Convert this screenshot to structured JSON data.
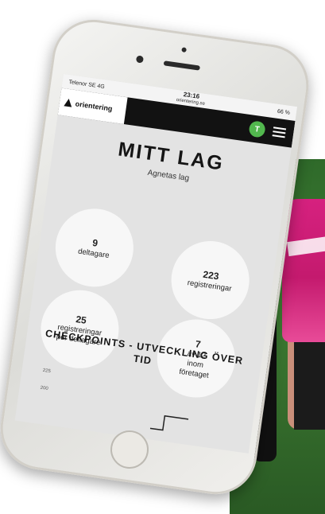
{
  "status_bar": {
    "carrier": "Telenor SE  4G",
    "time": "23:16",
    "url": "orientering.se",
    "battery": "66 %"
  },
  "header": {
    "logo_text": "orientering",
    "avatar_initial": "T",
    "colors": {
      "bar": "#121212",
      "avatar": "#52b84e"
    }
  },
  "page": {
    "title": "MITT LAG",
    "team_name": "Agnetas lag"
  },
  "stats": [
    {
      "number": "9",
      "lines": [
        "deltagare"
      ]
    },
    {
      "number": "223",
      "lines": [
        "registreringar"
      ]
    },
    {
      "number": "25",
      "lines": [
        "registreringar",
        "per deltagare"
      ]
    },
    {
      "number": "7",
      "lines": [
        "av 12",
        "inom",
        "företaget"
      ]
    }
  ],
  "checkpoints": {
    "title": "CHECKPOINTS - UTVECKLING ÖVER TID",
    "y_tick_top": "225",
    "y_tick_next": "200"
  }
}
